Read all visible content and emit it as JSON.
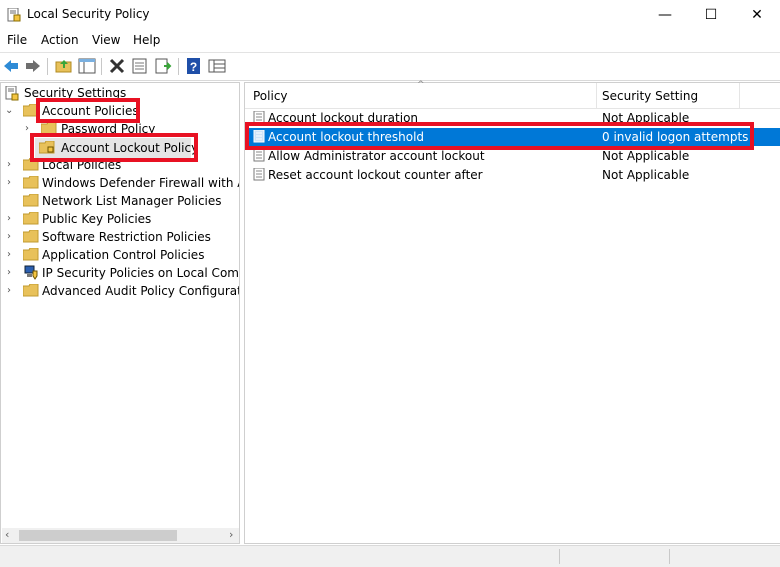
{
  "window": {
    "title": "Local Security Policy",
    "minimize": "—",
    "maximize": "☐",
    "close": "✕"
  },
  "menu": [
    "File",
    "Action",
    "View",
    "Help"
  ],
  "toolbar": {
    "icons": [
      "back-arrow-icon",
      "forward-arrow-icon",
      "up-folder-icon",
      "show-hide-tree-icon",
      "delete-icon",
      "properties-icon",
      "export-list-icon",
      "help-icon",
      "view-pane-icon"
    ]
  },
  "tree": {
    "root": "Security Settings",
    "items": [
      {
        "label": "Account Policies",
        "level": 1,
        "expanded": true
      },
      {
        "label": "Password Policy",
        "level": 2
      },
      {
        "label": "Account Lockout Policy",
        "level": 2,
        "selected": true
      },
      {
        "label": "Local Policies",
        "level": 1
      },
      {
        "label": "Windows Defender Firewall with Adva",
        "level": 1
      },
      {
        "label": "Network List Manager Policies",
        "level": 1
      },
      {
        "label": "Public Key Policies",
        "level": 1
      },
      {
        "label": "Software Restriction Policies",
        "level": 1
      },
      {
        "label": "Application Control Policies",
        "level": 1
      },
      {
        "label": "IP Security Policies on Local Compute",
        "level": 1
      },
      {
        "label": "Advanced Audit Policy Configuration",
        "level": 1
      }
    ]
  },
  "list": {
    "columns": [
      "Policy",
      "Security Setting"
    ],
    "rows": [
      {
        "policy": "Account lockout duration",
        "setting": "Not Applicable"
      },
      {
        "policy": "Account lockout threshold",
        "setting": "0 invalid logon attempts",
        "selected": true
      },
      {
        "policy": "Allow Administrator account lockout",
        "setting": "Not Applicable"
      },
      {
        "policy": "Reset account lockout counter after",
        "setting": "Not Applicable"
      }
    ]
  },
  "colors": {
    "selection": "#0078d7",
    "highlight_box": "#e81123",
    "folder": "#e8c15a"
  }
}
